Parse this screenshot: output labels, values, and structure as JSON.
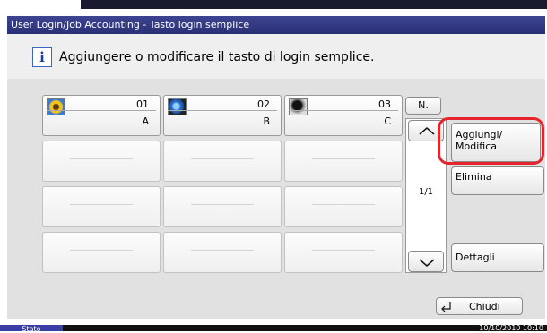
{
  "title": "User Login/Job Accounting - Tasto login semplice",
  "message": "Aggiungere o modificare il tasto di login semplice.",
  "info_icon": "i",
  "keys": [
    {
      "number": "01",
      "label": "A",
      "icon": "sunflower-icon"
    },
    {
      "number": "02",
      "label": "B",
      "icon": "globe-icon"
    },
    {
      "number": "03",
      "label": "C",
      "icon": "person-silhouette-icon"
    }
  ],
  "nav": {
    "n_label": "N.",
    "page": "1/1",
    "up_icon": "chevron-up-icon",
    "down_icon": "chevron-down-icon"
  },
  "actions": {
    "add_modify": "Aggiungi/\nModifica",
    "delete": "Elimina",
    "details": "Dettagli"
  },
  "close_label": "Chiudi",
  "status": {
    "stato": "Stato",
    "datetime": "10/10/2010  10:10"
  },
  "colors": {
    "title_bar": "#2f3680",
    "highlight": "#e5242b"
  }
}
